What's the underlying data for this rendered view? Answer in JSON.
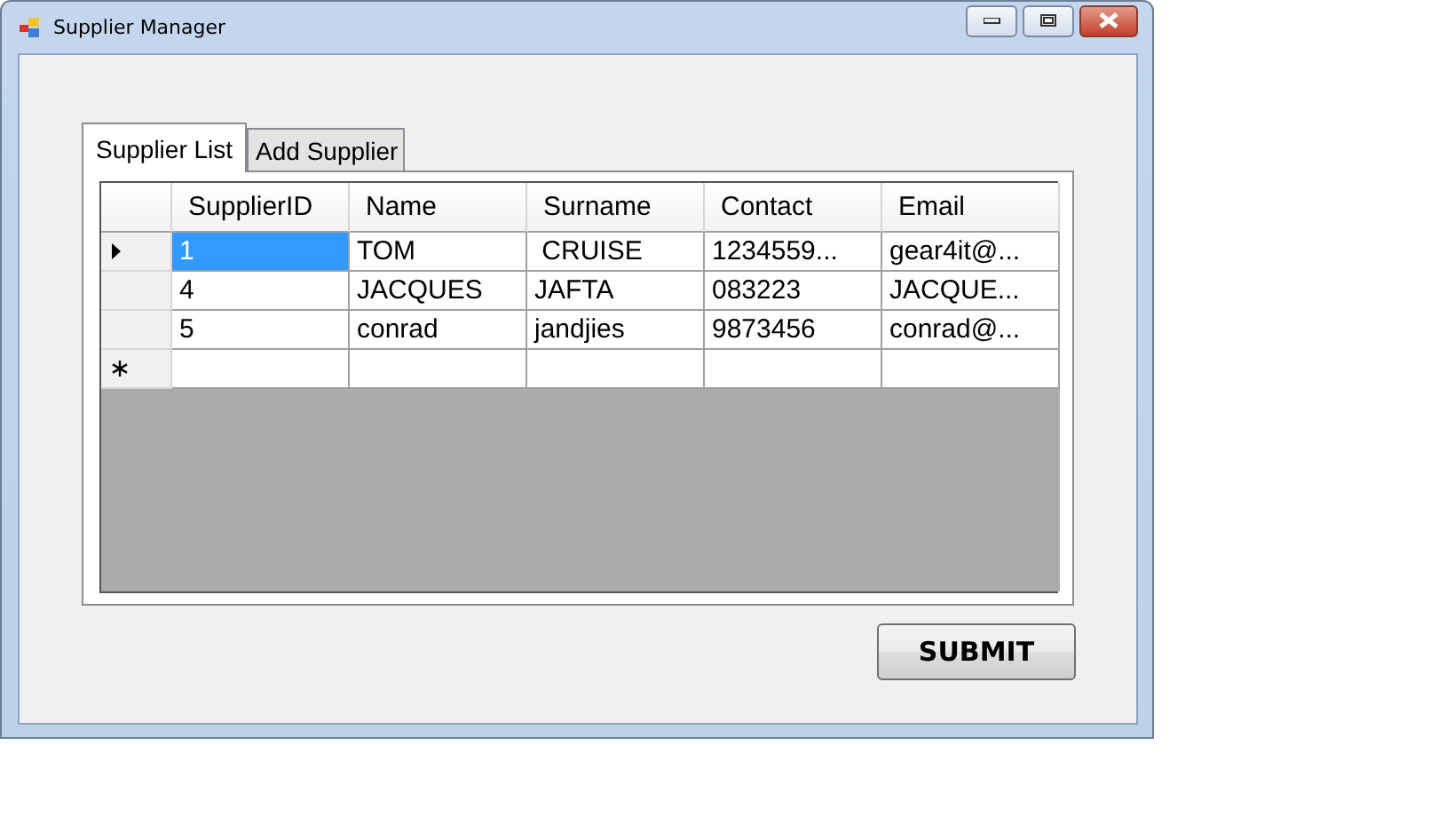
{
  "window": {
    "title": "Supplier Manager"
  },
  "tabs": [
    {
      "label": "Supplier List",
      "selected": true
    },
    {
      "label": "Add Supplier",
      "selected": false
    }
  ],
  "table": {
    "columns": [
      "SupplierID",
      "Name",
      "Surname",
      "Contact",
      "Email"
    ],
    "rows": [
      {
        "kind": "data",
        "current": true,
        "cells": [
          {
            "text": "1",
            "selected": true
          },
          {
            "text": "TOM",
            "selected": false
          },
          {
            "text": " CRUISE",
            "selected": false
          },
          {
            "text": "1234559...",
            "selected": false
          },
          {
            "text": "gear4it@...",
            "selected": false
          }
        ]
      },
      {
        "kind": "data",
        "current": false,
        "cells": [
          {
            "text": "4",
            "selected": false
          },
          {
            "text": "JACQUES",
            "selected": false
          },
          {
            "text": "JAFTA",
            "selected": false
          },
          {
            "text": "083223",
            "selected": false
          },
          {
            "text": "JACQUE...",
            "selected": false
          }
        ]
      },
      {
        "kind": "data",
        "current": false,
        "cells": [
          {
            "text": "5",
            "selected": false
          },
          {
            "text": "conrad",
            "selected": false
          },
          {
            "text": "jandjies",
            "selected": false
          },
          {
            "text": "9873456",
            "selected": false
          },
          {
            "text": "conrad@...",
            "selected": false
          }
        ]
      },
      {
        "kind": "new",
        "current": false,
        "cells": []
      }
    ]
  },
  "buttons": [
    "SUBMIT"
  ]
}
